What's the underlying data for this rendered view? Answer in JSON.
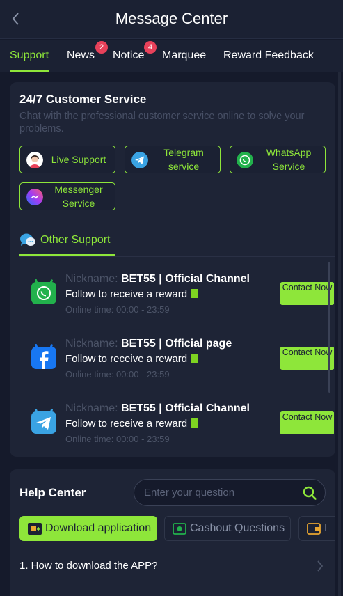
{
  "header": {
    "title": "Message Center",
    "back_icon": "chevron-left-icon"
  },
  "tabs": [
    {
      "label": "Support",
      "active": true
    },
    {
      "label": "News",
      "badge": "2"
    },
    {
      "label": "Notice",
      "badge": "4"
    },
    {
      "label": "Marquee"
    },
    {
      "label": "Reward Feedback"
    }
  ],
  "customer_service": {
    "title": "24/7 Customer Service",
    "subtitle": "Chat with the professional customer service online to solve your problems.",
    "services": [
      {
        "label": "Live Support",
        "icon": "agent-avatar-icon"
      },
      {
        "label": "Telegram service",
        "icon": "telegram-icon"
      },
      {
        "label": "WhatsApp Service",
        "icon": "whatsapp-icon"
      },
      {
        "label": "Messenger Service",
        "icon": "messenger-icon"
      }
    ]
  },
  "other_support": {
    "label": "Other Support",
    "icon": "chat-bubbles-icon",
    "channels": [
      {
        "nickname_key": "Nickname:",
        "nickname": "BET55 | Official Channel",
        "follow": "Follow to receive a reward",
        "online": "Online time: 00:00 - 23:59",
        "contact_label": "Contact Now",
        "icon": "whatsapp-icon"
      },
      {
        "nickname_key": "Nickname:",
        "nickname": "BET55 | Official page",
        "follow": "Follow to receive a reward",
        "online": "Online time: 00:00 - 23:59",
        "contact_label": "Contact Now",
        "icon": "facebook-icon"
      },
      {
        "nickname_key": "Nickname:",
        "nickname": "BET55 | Official Channel",
        "follow": "Follow to receive a reward",
        "online": "Online time: 00:00 - 23:59",
        "contact_label": "Contact Now",
        "icon": "telegram-icon"
      }
    ]
  },
  "help_center": {
    "title": "Help Center",
    "search_placeholder": "Enter your question",
    "categories": [
      {
        "label": "Download application",
        "active": true,
        "icon": "app-download-icon"
      },
      {
        "label": "Cashout Questions",
        "icon": "cashout-icon"
      },
      {
        "label": "I",
        "icon": "wallet-icon"
      }
    ],
    "faq_items": [
      "1. How to download the APP?"
    ]
  },
  "colors": {
    "accent": "#8ee63a",
    "background": "#151a2b",
    "card": "#1e2436",
    "badge": "#e8415a"
  }
}
